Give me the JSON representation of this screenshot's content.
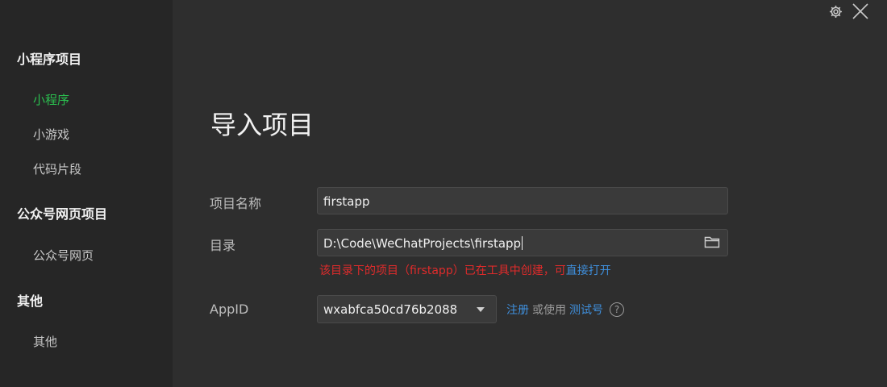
{
  "sidebar": {
    "sections": [
      {
        "title": "小程序项目",
        "items": [
          "小程序",
          "小游戏",
          "代码片段"
        ]
      },
      {
        "title": "公众号网页项目",
        "items": [
          "公众号网页"
        ]
      },
      {
        "title": "其他",
        "items": [
          "其他"
        ]
      }
    ],
    "active_item": "小程序"
  },
  "window": {
    "settings_icon": "gear-icon",
    "close_icon": "close-icon"
  },
  "main": {
    "title": "导入项目",
    "project_name": {
      "label": "项目名称",
      "value": "firstapp"
    },
    "directory": {
      "label": "目录",
      "value": "D:\\Code\\WeChatProjects\\firstapp",
      "browse_icon": "folder-icon",
      "error_text": "该目录下的项目（firstapp）已在工具中创建，可",
      "error_link": "直接打开"
    },
    "appid": {
      "label": "AppID",
      "selected": "wxabfca50cd76b2088",
      "register_link": "注册",
      "or_use_text": "或使用",
      "test_link": "测试号",
      "help_icon": "help-icon"
    }
  },
  "colors": {
    "accent": "#2bbf4f",
    "error": "#e02b2b",
    "link": "#3f8fdc",
    "background": "#2e2e2e",
    "sidebar_bg": "#262626"
  }
}
